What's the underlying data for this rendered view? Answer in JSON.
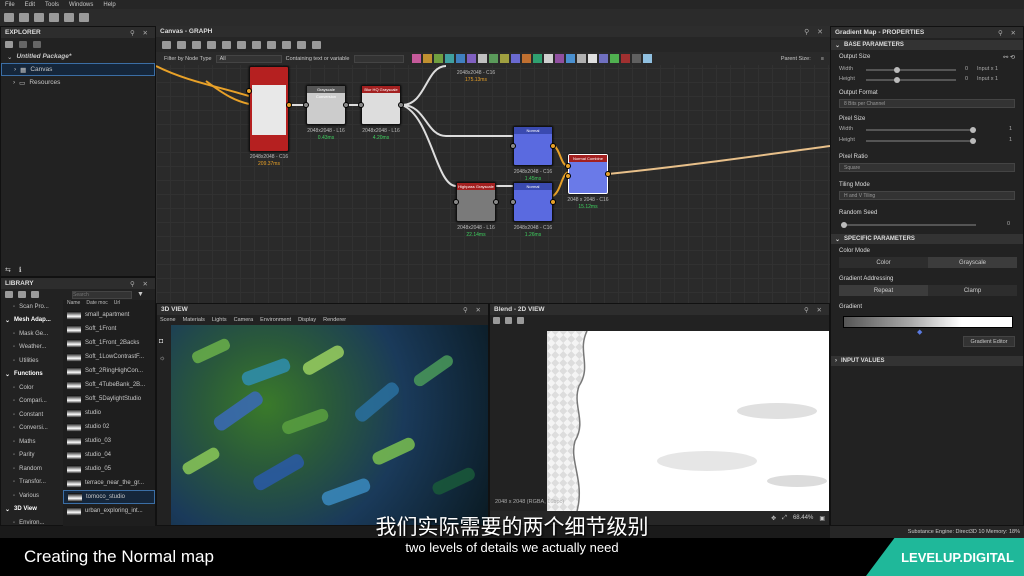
{
  "menu": [
    "File",
    "Edit",
    "Tools",
    "Windows",
    "Help"
  ],
  "explorer": {
    "title": "EXPLORER",
    "package": "Untitled Package*",
    "canvas": "Canvas",
    "resources": "Resources"
  },
  "graph": {
    "title": "Canvas - GRAPH",
    "filter_label": "Filter by Node Type",
    "filter_value": "All",
    "containing_label": "Containing text or variable",
    "parent_size": "Parent Size:",
    "nodes": [
      {
        "title": "",
        "res": "2048x2048 - C16",
        "time": "209.37ms"
      },
      {
        "title": "Grayscale Conversion",
        "res": "2048x2048 - L16",
        "time": "0.43ms"
      },
      {
        "title": "Blur HQ Grayscale",
        "res": "2048x2048 - L16",
        "time": "4.20ms"
      },
      {
        "title": "",
        "res": "2048x2048 - C16",
        "time": "175.13ms"
      },
      {
        "title": "Normal",
        "res": "2048x2048 - C16",
        "time": "1.45ms"
      },
      {
        "title": "Highpass Grayscale",
        "res": "2048x2048 - L16",
        "time": "22.14ms"
      },
      {
        "title": "Normal",
        "res": "2048x2048 - C16",
        "time": "1.26ms"
      },
      {
        "title": "Normal Combine",
        "res": "2048 x 2048 - C16",
        "time": "15.12ms"
      }
    ]
  },
  "library": {
    "title": "LIBRARY",
    "search_placeholder": "Search",
    "col_name": "Name",
    "col_date": "Date moc",
    "col_url": "Url",
    "categories": [
      {
        "label": "Scan Pro...",
        "kind": "item"
      },
      {
        "label": "Mesh Adap...",
        "kind": "header"
      },
      {
        "label": "Mask Ge...",
        "kind": "item"
      },
      {
        "label": "Weather...",
        "kind": "item"
      },
      {
        "label": "Utilities",
        "kind": "item"
      },
      {
        "label": "Functions",
        "kind": "header"
      },
      {
        "label": "Color",
        "kind": "item"
      },
      {
        "label": "Compari...",
        "kind": "item"
      },
      {
        "label": "Constant",
        "kind": "item"
      },
      {
        "label": "Conversi...",
        "kind": "item"
      },
      {
        "label": "Maths",
        "kind": "item"
      },
      {
        "label": "Parity",
        "kind": "item"
      },
      {
        "label": "Random",
        "kind": "item"
      },
      {
        "label": "Transfor...",
        "kind": "item"
      },
      {
        "label": "Various",
        "kind": "item"
      },
      {
        "label": "3D View",
        "kind": "header"
      },
      {
        "label": "Environ...",
        "kind": "item"
      }
    ],
    "items": [
      "small_apartment",
      "Soft_1Front",
      "Soft_1Front_2Backs",
      "Soft_1LowContrastF...",
      "Soft_2RingHighCon...",
      "Soft_4TubeBank_2B...",
      "Soft_5DaylightStudio",
      "studio",
      "studio 02",
      "studio_03",
      "studio_04",
      "studio_05",
      "terrace_near_the_gr...",
      "tomoco_studio",
      "urban_exploring_int..."
    ]
  },
  "view3d": {
    "title": "3D VIEW",
    "menus": [
      "Scene",
      "Materials",
      "Lights",
      "Camera",
      "Environment",
      "Display",
      "Renderer"
    ]
  },
  "view2d": {
    "title": "Blend - 2D VIEW",
    "resolution": "2048 x 2048 (RGBA, 16bpc)",
    "zoom": "68.44%"
  },
  "properties": {
    "title": "Gradient Map - PROPERTIES",
    "base_section": "BASE PARAMETERS",
    "output_size": "Output Size",
    "width": "Width",
    "height": "Height",
    "width_val": "0",
    "height_val": "0",
    "width_rel": "Input x 1",
    "height_rel": "Input x 1",
    "output_format": "Output Format",
    "output_format_val": "8 Bits per Channel",
    "pixel_size": "Pixel Size",
    "pixel_w_val": "1",
    "pixel_h_val": "1",
    "pixel_ratio": "Pixel Ratio",
    "pixel_ratio_val": "Square",
    "tiling_mode": "Tiling Mode",
    "tiling_val": "H and V Tiling",
    "random_seed": "Random Seed",
    "random_seed_val": "0",
    "specific_section": "SPECIFIC PARAMETERS",
    "color_mode": "Color Mode",
    "color_btn": "Color",
    "grayscale_btn": "Grayscale",
    "gradient_addressing": "Gradient Addressing",
    "repeat_btn": "Repeat",
    "clamp_btn": "Clamp",
    "gradient": "Gradient",
    "gradient_editor": "Gradient Editor",
    "input_values": "INPUT VALUES"
  },
  "status": "Substance Engine: Direct3D 10   Memory: 18%",
  "subtitle_cn": "我们实际需要的两个细节级别",
  "subtitle_en": "two levels of details we actually need",
  "caption_title": "Creating the Normal map",
  "brand": "LEVELUP.DIGITAL",
  "colors": {
    "accent": "#e8a128",
    "brand": "#1fb89a",
    "selected": "#3b6ea5"
  }
}
